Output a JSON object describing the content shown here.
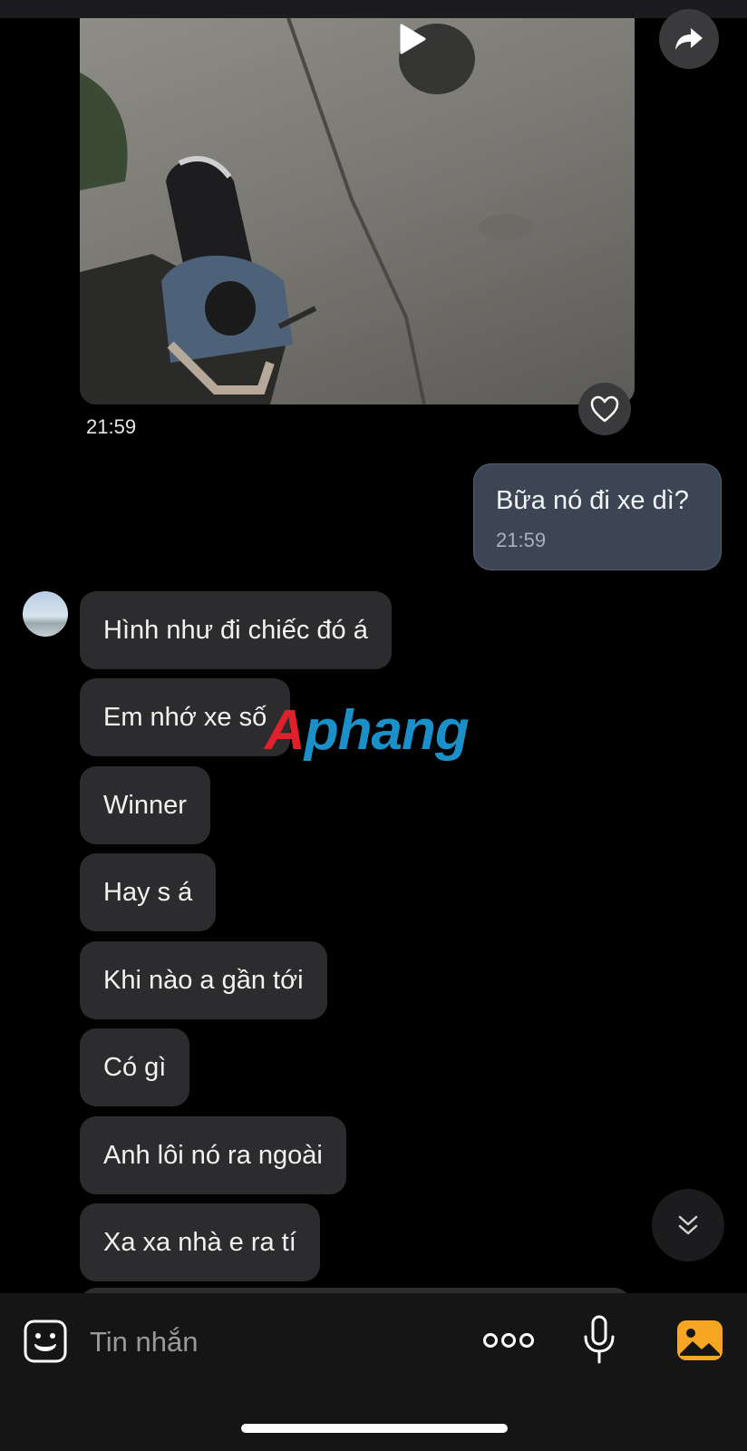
{
  "media": {
    "time": "21:59",
    "play_icon": "play-icon",
    "share_icon": "share-arrow-icon",
    "like_icon": "heart-icon"
  },
  "outgoing": {
    "text": "Bữa nó đi xe dì?",
    "time": "21:59"
  },
  "incoming": [
    {
      "text": "Hình như đi chiếc đó á"
    },
    {
      "text": "Em nhớ xe số"
    },
    {
      "text": "Winner"
    },
    {
      "text": "Hay s á"
    },
    {
      "text": "Khi nào a gần tới"
    },
    {
      "text": "Có gì"
    },
    {
      "text": "Anh lôi nó ra ngoài"
    },
    {
      "text": "Xa xa nhà e ra tí"
    }
  ],
  "watermark": {
    "first": "A",
    "rest": "phang"
  },
  "composer": {
    "placeholder": "Tin nhắn",
    "emoji_icon": "sticker-icon",
    "more_icon": "more-dots-icon",
    "mic_icon": "mic-icon",
    "photo_icon": "photo-icon"
  },
  "colors": {
    "background": "#000000",
    "incoming_bubble": "#2c2c2e",
    "outgoing_bubble": "#3b4553",
    "photo_icon": "#f5a623"
  }
}
